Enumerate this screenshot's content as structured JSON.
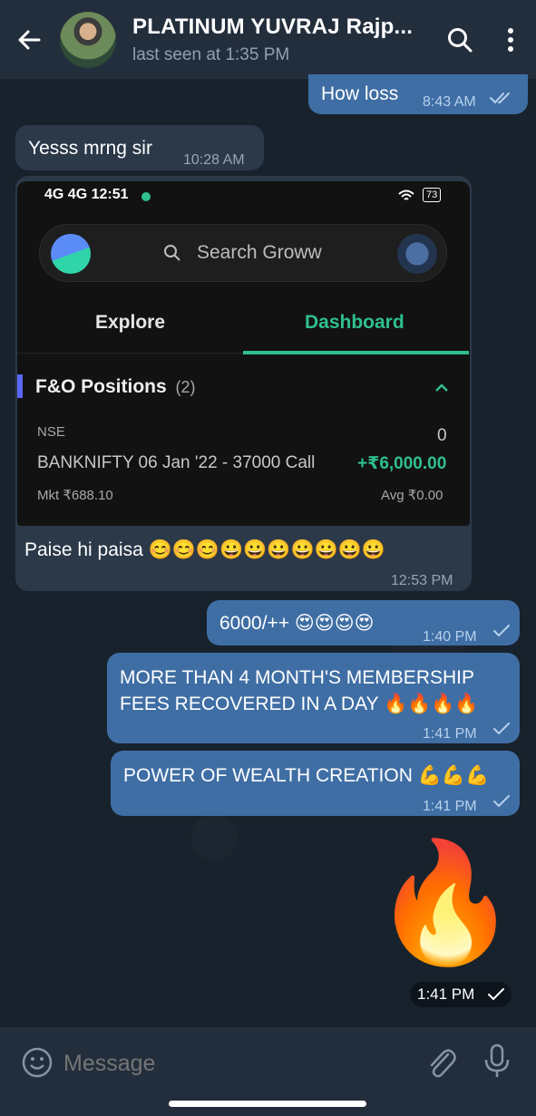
{
  "header": {
    "title": "PLATINUM YUVRAJ Rajp...",
    "status": "last seen at 1:35 PM"
  },
  "messages": {
    "m1": {
      "text": "How loss",
      "time": "8:43 AM"
    },
    "m2": {
      "text": "Yesss mrng sir",
      "time": "10:28 AM"
    },
    "m3": {
      "text": "Paise hi paisa 😊😊😊😀😀😀😀😀😀😀",
      "time": "12:53 PM"
    },
    "m4": {
      "text": "6000/++ 😍😍😍😍",
      "time": "1:40 PM"
    },
    "m5": {
      "line1": "MORE THAN 4 MONTH'S MEMBERSHIP",
      "line2": "FEES RECOVERED IN A DAY 🔥🔥🔥🔥",
      "time": "1:41 PM"
    },
    "m6": {
      "text": "POWER OF WEALTH CREATION 💪💪💪",
      "time": "1:41 PM"
    },
    "m7": {
      "sticker": "🔥",
      "time": "1:41 PM"
    }
  },
  "screenshot": {
    "status_left": "4G 4G 12:51",
    "status_right": "73",
    "search_placeholder": "Search Groww",
    "tab_explore": "Explore",
    "tab_dashboard": "Dashboard",
    "positions_title": "F&O Positions",
    "positions_count": "(2)",
    "exchange": "NSE",
    "qty": "0",
    "contract": "BANKNIFTY 06 Jan '22 - 37000 Call",
    "pnl": "+₹6,000.00",
    "mkt": "Mkt ₹688.10",
    "avg": "Avg ₹0.00",
    "colors": {
      "green": "#2fbf91",
      "accent_bar": "#5a67f6"
    }
  },
  "composer": {
    "placeholder": "Message"
  },
  "icons": [
    "back-arrow-icon",
    "search-icon",
    "more-vertical-icon",
    "emoji-icon",
    "attach-icon",
    "mic-icon",
    "double-check-icon",
    "check-icon",
    "chevron-up-icon"
  ],
  "colors": {
    "header_bg": "#232e3c",
    "incoming_bubble": "#2b3949",
    "outgoing_bubble": "#3f6ea4"
  }
}
